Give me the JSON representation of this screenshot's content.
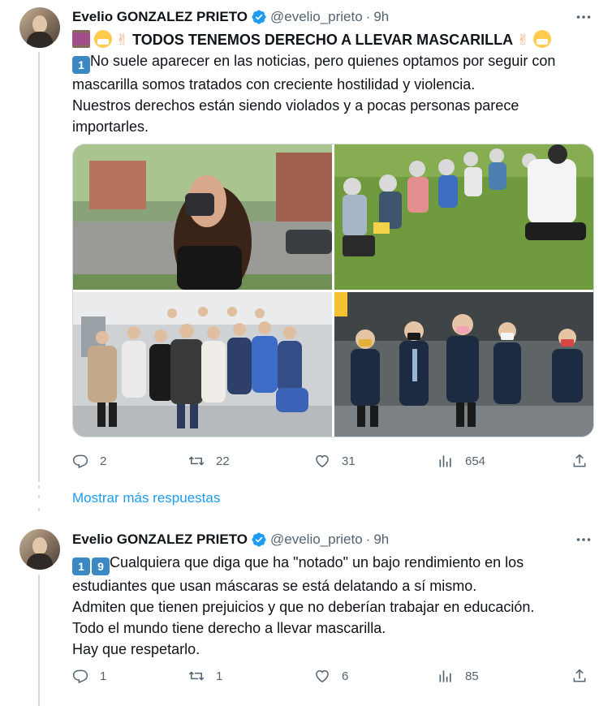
{
  "tweets": [
    {
      "author_name": "Evelio GONZALEZ PRIETO",
      "handle": "@evelio_prieto",
      "separator": "·",
      "time": "9h",
      "more_label": "•••",
      "headline": "TODOS TENEMOS DERECHO A LLEVAR MASCARILLA",
      "number_badge": "1",
      "lines": [
        "No suele aparecer en las noticias, pero quienes optamos por seguir con",
        "mascarilla somos tratados con creciente hostilidad y violencia.",
        "Nuestros derechos están siendo violados y a pocas personas parece",
        "importarles."
      ],
      "stats": {
        "replies": "2",
        "retweets": "22",
        "likes": "31",
        "views": "654"
      }
    },
    {
      "author_name": "Evelio GONZALEZ PRIETO",
      "handle": "@evelio_prieto",
      "separator": "·",
      "time": "9h",
      "more_label": "•••",
      "number_badges": [
        "1",
        "9"
      ],
      "lines": [
        "Cualquiera que diga que ha \"notado\" un bajo rendimiento en los",
        "estudiantes que usan máscaras se está delatando a sí mismo.",
        "Admiten que tienen prejuicios y que no deberían trabajar en educación.",
        "Todo el mundo tiene derecho a llevar mascarilla.",
        "Hay que respetarlo."
      ],
      "stats": {
        "replies": "1",
        "retweets": "1",
        "likes": "6",
        "views": "85"
      }
    }
  ],
  "show_more_replies": "Mostrar más respuestas",
  "colors": {
    "accent": "#1d9bf0",
    "text": "#0f1419",
    "muted": "#536471",
    "border": "#cfd9de"
  }
}
